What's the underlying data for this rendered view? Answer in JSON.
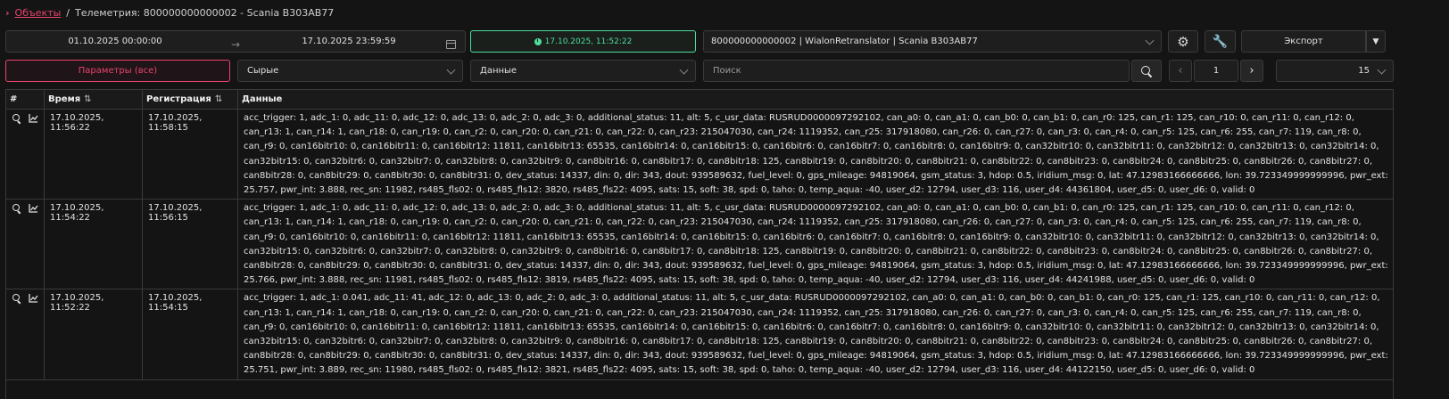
{
  "breadcrumb": {
    "chevron": "›",
    "root": "Объекты",
    "separator": "/",
    "current": "Телеметрия: 800000000000002 - Scania В303АВ77"
  },
  "toolbar": {
    "date_from": "01.10.2025 00:00:00",
    "date_to": "17.10.2025 23:59:59",
    "current_time": "17.10.2025, 11:52:22",
    "device_select": "800000000000002 | WialonRetranslator | Scania В303АВ77",
    "export_label": "Экспорт",
    "params_button": "Параметры (все)",
    "raw_select": "Сырые",
    "data_select": "Данные",
    "search_placeholder": "Поиск",
    "page_number": "1",
    "page_size": "15"
  },
  "table": {
    "columns": [
      "#",
      "Время",
      "Регистрация",
      "Данные"
    ],
    "rows": [
      {
        "time": "17.10.2025, 11:56:22",
        "registration": "17.10.2025, 11:58:15",
        "data": "acc_trigger: 1, adc_1: 0, adc_11: 0, adc_12: 0, adc_13: 0, adc_2: 0, adc_3: 0, additional_status: 11, alt: 5, c_usr_data: RUSRUD0000097292102, can_a0: 0, can_a1: 0, can_b0: 0, can_b1: 0, can_r0: 125, can_r1: 125, can_r10: 0, can_r11: 0, can_r12: 0, can_r13: 1, can_r14: 1, can_r18: 0, can_r19: 0, can_r2: 0, can_r20: 0, can_r21: 0, can_r22: 0, can_r23: 215047030, can_r24: 1119352, can_r25: 317918080, can_r26: 0, can_r27: 0, can_r3: 0, can_r4: 0, can_r5: 125, can_r6: 255, can_r7: 119, can_r8: 0, can_r9: 0, can16bitr10: 0, can16bitr11: 0, can16bitr12: 11811, can16bitr13: 65535, can16bitr14: 0, can16bitr15: 0, can16bitr6: 0, can16bitr7: 0, can16bitr8: 0, can16bitr9: 0, can32bitr10: 0, can32bitr11: 0, can32bitr12: 0, can32bitr13: 0, can32bitr14: 0, can32bitr15: 0, can32bitr6: 0, can32bitr7: 0, can32bitr8: 0, can32bitr9: 0, can8bitr16: 0, can8bitr17: 0, can8bitr18: 125, can8bitr19: 0, can8bitr20: 0, can8bitr21: 0, can8bitr22: 0, can8bitr23: 0, can8bitr24: 0, can8bitr25: 0, can8bitr26: 0, can8bitr27: 0, can8bitr28: 0, can8bitr29: 0, can8bitr30: 0, can8bitr31: 0, dev_status: 14337, din: 0, dir: 343, dout: 939589632, fuel_level: 0, gps_mileage: 94819064, gsm_status: 3, hdop: 0.5, iridium_msg: 0, lat: 47.12983166666666, lon: 39.723349999999996, pwr_ext: 25.757, pwr_int: 3.888, rec_sn: 11982, rs485_fls02: 0, rs485_fls12: 3820, rs485_fls22: 4095, sats: 15, soft: 38, spd: 0, taho: 0, temp_aqua: -40, user_d2: 12794, user_d3: 116, user_d4: 44361804, user_d5: 0, user_d6: 0, valid: 0"
      },
      {
        "time": "17.10.2025, 11:54:22",
        "registration": "17.10.2025, 11:56:15",
        "data": "acc_trigger: 1, adc_1: 0, adc_11: 0, adc_12: 0, adc_13: 0, adc_2: 0, adc_3: 0, additional_status: 11, alt: 5, c_usr_data: RUSRUD0000097292102, can_a0: 0, can_a1: 0, can_b0: 0, can_b1: 0, can_r0: 125, can_r1: 125, can_r10: 0, can_r11: 0, can_r12: 0, can_r13: 1, can_r14: 1, can_r18: 0, can_r19: 0, can_r2: 0, can_r20: 0, can_r21: 0, can_r22: 0, can_r23: 215047030, can_r24: 1119352, can_r25: 317918080, can_r26: 0, can_r27: 0, can_r3: 0, can_r4: 0, can_r5: 125, can_r6: 255, can_r7: 119, can_r8: 0, can_r9: 0, can16bitr10: 0, can16bitr11: 0, can16bitr12: 11811, can16bitr13: 65535, can16bitr14: 0, can16bitr15: 0, can16bitr6: 0, can16bitr7: 0, can16bitr8: 0, can16bitr9: 0, can32bitr10: 0, can32bitr11: 0, can32bitr12: 0, can32bitr13: 0, can32bitr14: 0, can32bitr15: 0, can32bitr6: 0, can32bitr7: 0, can32bitr8: 0, can32bitr9: 0, can8bitr16: 0, can8bitr17: 0, can8bitr18: 125, can8bitr19: 0, can8bitr20: 0, can8bitr21: 0, can8bitr22: 0, can8bitr23: 0, can8bitr24: 0, can8bitr25: 0, can8bitr26: 0, can8bitr27: 0, can8bitr28: 0, can8bitr29: 0, can8bitr30: 0, can8bitr31: 0, dev_status: 14337, din: 0, dir: 343, dout: 939589632, fuel_level: 0, gps_mileage: 94819064, gsm_status: 3, hdop: 0.5, iridium_msg: 0, lat: 47.12983166666666, lon: 39.723349999999996, pwr_ext: 25.766, pwr_int: 3.888, rec_sn: 11981, rs485_fls02: 0, rs485_fls12: 3819, rs485_fls22: 4095, sats: 15, soft: 38, spd: 0, taho: 0, temp_aqua: -40, user_d2: 12794, user_d3: 116, user_d4: 44241988, user_d5: 0, user_d6: 0, valid: 0"
      },
      {
        "time": "17.10.2025, 11:52:22",
        "registration": "17.10.2025, 11:54:15",
        "data": "acc_trigger: 1, adc_1: 0.041, adc_11: 41, adc_12: 0, adc_13: 0, adc_2: 0, adc_3: 0, additional_status: 11, alt: 5, c_usr_data: RUSRUD0000097292102, can_a0: 0, can_a1: 0, can_b0: 0, can_b1: 0, can_r0: 125, can_r1: 125, can_r10: 0, can_r11: 0, can_r12: 0, can_r13: 1, can_r14: 1, can_r18: 0, can_r19: 0, can_r2: 0, can_r20: 0, can_r21: 0, can_r22: 0, can_r23: 215047030, can_r24: 1119352, can_r25: 317918080, can_r26: 0, can_r27: 0, can_r3: 0, can_r4: 0, can_r5: 125, can_r6: 255, can_r7: 119, can_r8: 0, can_r9: 0, can16bitr10: 0, can16bitr11: 0, can16bitr12: 11811, can16bitr13: 65535, can16bitr14: 0, can16bitr15: 0, can16bitr6: 0, can16bitr7: 0, can16bitr8: 0, can16bitr9: 0, can32bitr10: 0, can32bitr11: 0, can32bitr12: 0, can32bitr13: 0, can32bitr14: 0, can32bitr15: 0, can32bitr6: 0, can32bitr7: 0, can32bitr8: 0, can32bitr9: 0, can8bitr16: 0, can8bitr17: 0, can8bitr18: 125, can8bitr19: 0, can8bitr20: 0, can8bitr21: 0, can8bitr22: 0, can8bitr23: 0, can8bitr24: 0, can8bitr25: 0, can8bitr26: 0, can8bitr27: 0, can8bitr28: 0, can8bitr29: 0, can8bitr30: 0, can8bitr31: 0, dev_status: 14337, din: 0, dir: 343, dout: 939589632, fuel_level: 0, gps_mileage: 94819064, gsm_status: 3, hdop: 0.5, iridium_msg: 0, lat: 47.12983166666666, lon: 39.723349999999996, pwr_ext: 25.751, pwr_int: 3.889, rec_sn: 11980, rs485_fls02: 0, rs485_fls12: 3821, rs485_fls22: 4095, sats: 15, soft: 38, spd: 0, taho: 0, temp_aqua: -40, user_d2: 12794, user_d3: 116, user_d4: 44122150, user_d5: 0, user_d6: 0, valid: 0"
      }
    ]
  },
  "colors": {
    "accent": "#e8436b",
    "time_accent": "#4ddc9a",
    "background": "#141414"
  },
  "icons": {
    "row_view": "magnifier-icon",
    "row_chart": "chart-icon",
    "settings": "gear-icon",
    "tools": "wrench-icon",
    "sort": "sort-icon"
  }
}
